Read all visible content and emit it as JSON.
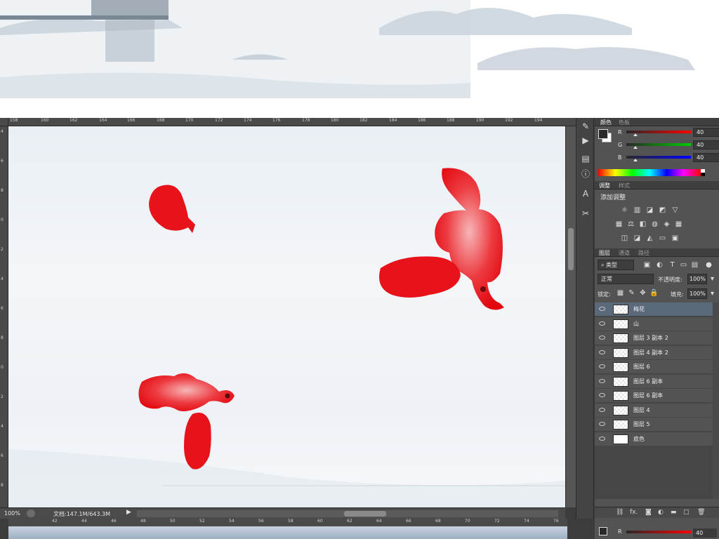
{
  "statusbar": {
    "zoom": "100%",
    "doc_info": "文档:147.1M/643.3M"
  },
  "rulers": {
    "top": [
      "158",
      "160",
      "162",
      "164",
      "166",
      "168",
      "170",
      "172",
      "174",
      "176",
      "178",
      "180",
      "182",
      "184",
      "186",
      "188",
      "190",
      "192",
      "194"
    ],
    "left": [
      "4",
      "6",
      "8",
      "0",
      "2",
      "4",
      "6",
      "8",
      "0",
      "2",
      "4",
      "6",
      "8"
    ],
    "bottom_top": [
      "42",
      "44",
      "46",
      "48",
      "50",
      "52",
      "54",
      "56",
      "58",
      "60",
      "62",
      "64",
      "66",
      "68",
      "70",
      "72",
      "74",
      "76"
    ]
  },
  "color_panel": {
    "tabs": [
      "颜色",
      "色板"
    ],
    "channels": [
      {
        "label": "R",
        "value": "40",
        "bar": "#ff0000"
      },
      {
        "label": "G",
        "value": "40",
        "bar": "#00cc00"
      },
      {
        "label": "B",
        "value": "40",
        "bar": "#0000ff"
      }
    ]
  },
  "adjust_panel": {
    "tabs": [
      "调整",
      "样式"
    ],
    "title": "添加调整",
    "row1": [
      "sun-icon",
      "levels-icon",
      "curves-icon",
      "exposure-icon",
      "triangle-icon"
    ],
    "row2": [
      "vibrance-icon",
      "balance-icon",
      "bw-icon",
      "photo-filter-icon",
      "mixer-icon",
      "lookup-icon"
    ],
    "row3": [
      "invert-icon",
      "posterize-icon",
      "threshold-icon",
      "gradient-map-icon",
      "selective-color-icon"
    ]
  },
  "layers_panel": {
    "tabs": [
      "图层",
      "通道",
      "路径"
    ],
    "filter_kind": "类型",
    "blend_mode": "正常",
    "opacity_label": "不透明度:",
    "opacity_value": "100%",
    "lock_label": "锁定:",
    "fill_label": "填充:",
    "fill_value": "100%",
    "layers": [
      {
        "name": "梅花",
        "selected": true,
        "solid": false
      },
      {
        "name": "山",
        "selected": false,
        "solid": false
      },
      {
        "name": "图层 3 副本 2",
        "selected": false,
        "solid": false
      },
      {
        "name": "图层 4 副本 2",
        "selected": false,
        "solid": false
      },
      {
        "name": "图层 6",
        "selected": false,
        "solid": false
      },
      {
        "name": "图层 6 副本",
        "selected": false,
        "solid": false
      },
      {
        "name": "图层 6 副本",
        "selected": false,
        "solid": false
      },
      {
        "name": "图层 4",
        "selected": false,
        "solid": false
      },
      {
        "name": "图层 5",
        "selected": false,
        "solid": false
      },
      {
        "name": "底色",
        "selected": false,
        "solid": true
      }
    ],
    "footer_icons": [
      "link-icon",
      "fx-icon",
      "mask-icon",
      "adjustment-icon",
      "folder-icon",
      "new-layer-icon",
      "trash-icon"
    ]
  },
  "colors": {
    "petal": "#e8121a",
    "panel": "#535353",
    "selected_row": "#5b6a7b"
  }
}
